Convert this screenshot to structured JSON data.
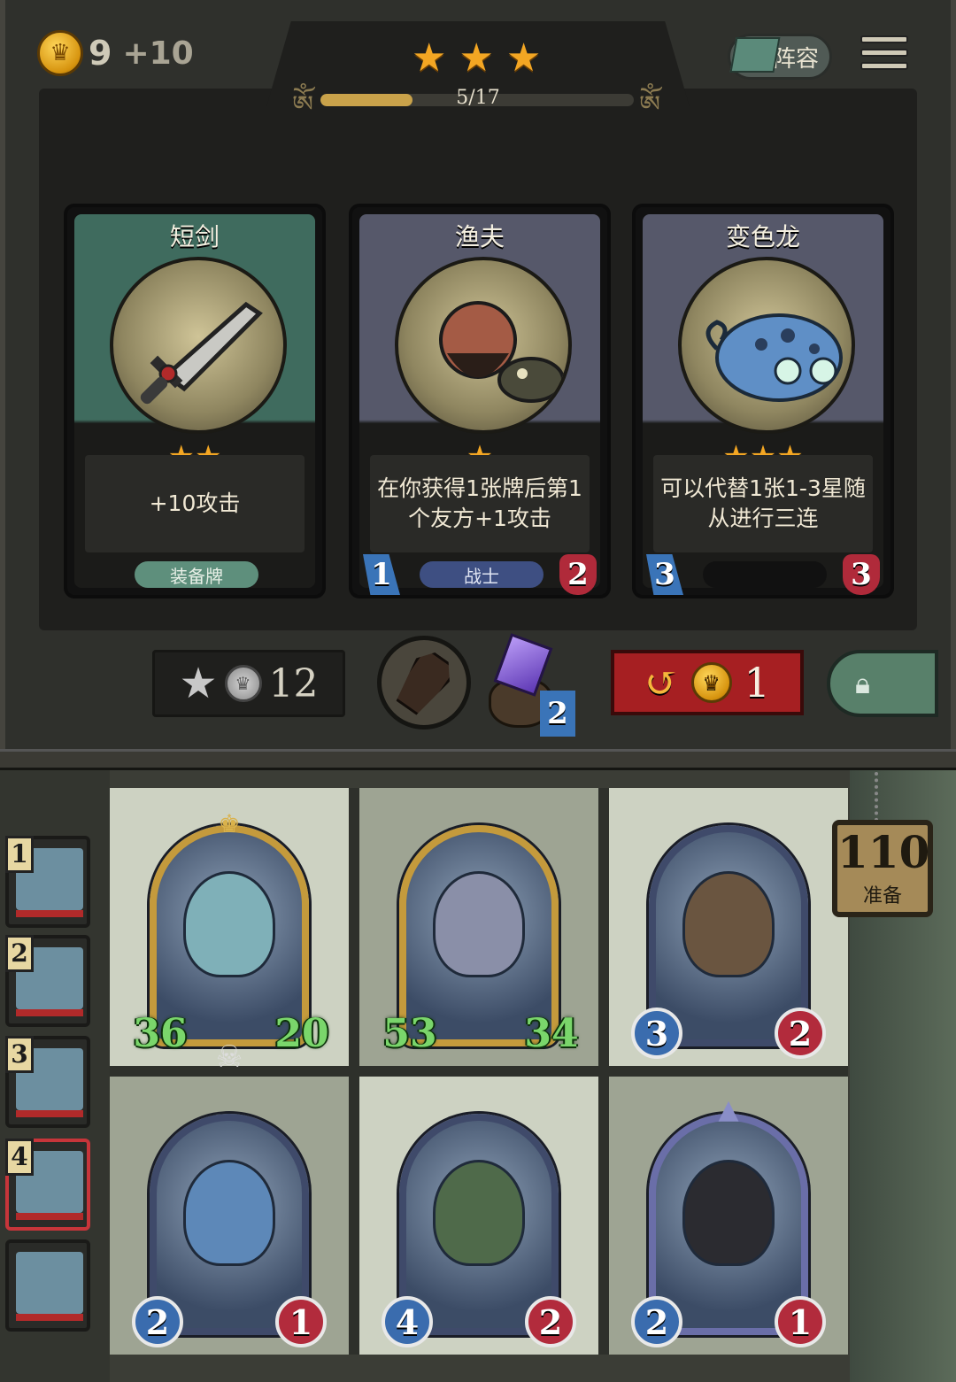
{
  "top_bar": {
    "gold": "9",
    "gold_income": "+10",
    "tier_stars": 3,
    "progress_text": "5/17",
    "progress_fraction": 0.294,
    "lineup_label": "阵容"
  },
  "shop_cards": [
    {
      "name": "短剑",
      "stars": 2,
      "description": "+10攻击",
      "tag": "装备牌",
      "attack": "",
      "health": "",
      "theme": "#3f6b5e"
    },
    {
      "name": "渔夫",
      "stars": 1,
      "description": "在你获得1张牌后第1个友方+1攻击",
      "tag": "战士",
      "attack": "1",
      "health": "2",
      "theme": "#56586a"
    },
    {
      "name": "变色龙",
      "stars": 3,
      "description": "可以代替1张1-3星随从进行三连",
      "tag": "",
      "attack": "3",
      "health": "3",
      "theme": "#56586a"
    }
  ],
  "actions": {
    "upgrade_cost": "12",
    "gem_count": "2",
    "refresh_cost": "1"
  },
  "ranking": [
    {
      "rank": "1"
    },
    {
      "rank": "2"
    },
    {
      "rank": "3"
    },
    {
      "rank": "4"
    },
    {
      "rank": ""
    }
  ],
  "board": [
    {
      "attack": "36",
      "health": "20",
      "buffed": true,
      "frame": "gold"
    },
    {
      "attack": "53",
      "health": "34",
      "buffed": true,
      "frame": "gold"
    },
    {
      "attack": "3",
      "health": "2",
      "buffed": false,
      "frame": "blue"
    },
    {
      "attack": "2",
      "health": "1",
      "buffed": false,
      "frame": "blue"
    },
    {
      "attack": "4",
      "health": "2",
      "buffed": false,
      "frame": "blue"
    },
    {
      "attack": "2",
      "health": "1",
      "buffed": false,
      "frame": "purple"
    }
  ],
  "prep": {
    "count": "110",
    "label": "准备"
  },
  "colors": {
    "gold": "#f3a623",
    "attack_blue": "#3a6cae",
    "health_red": "#b22b3c",
    "refresh_red": "#a61f22",
    "buff_green": "#7ad66b"
  }
}
